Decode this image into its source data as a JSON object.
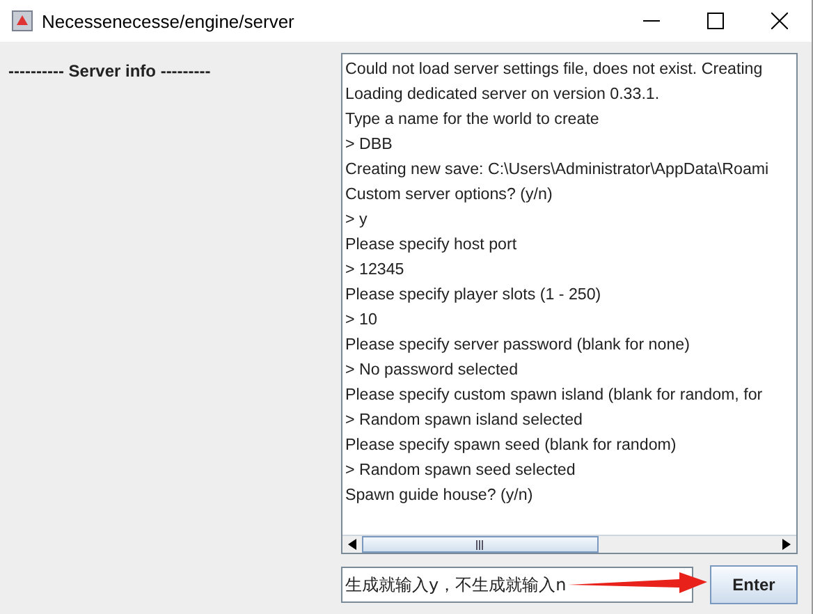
{
  "window": {
    "title": "Necessenecesse/engine/server"
  },
  "sidebar": {
    "heading": "---------- Server info ---------"
  },
  "console": {
    "lines": [
      "Could not load server settings file, does not exist. Creating",
      "Loading dedicated server on version 0.33.1.",
      "Type a name for the world to create",
      "> DBB",
      "Creating new save: C:\\Users\\Administrator\\AppData\\Roami",
      "Custom server options? (y/n)",
      "> y",
      "Please specify host port",
      "> 12345",
      "Please specify player slots (1 - 250)",
      "> 10",
      "Please specify server password (blank for none)",
      "> No password selected",
      "Please specify custom spawn island (blank for random, for",
      "> Random spawn island selected",
      "Please specify spawn seed (blank for random)",
      "> Random spawn seed selected",
      "Spawn guide house? (y/n)"
    ]
  },
  "input": {
    "value": "生成就输入y，不生成就输入n"
  },
  "enter_button": {
    "label": "Enter"
  }
}
